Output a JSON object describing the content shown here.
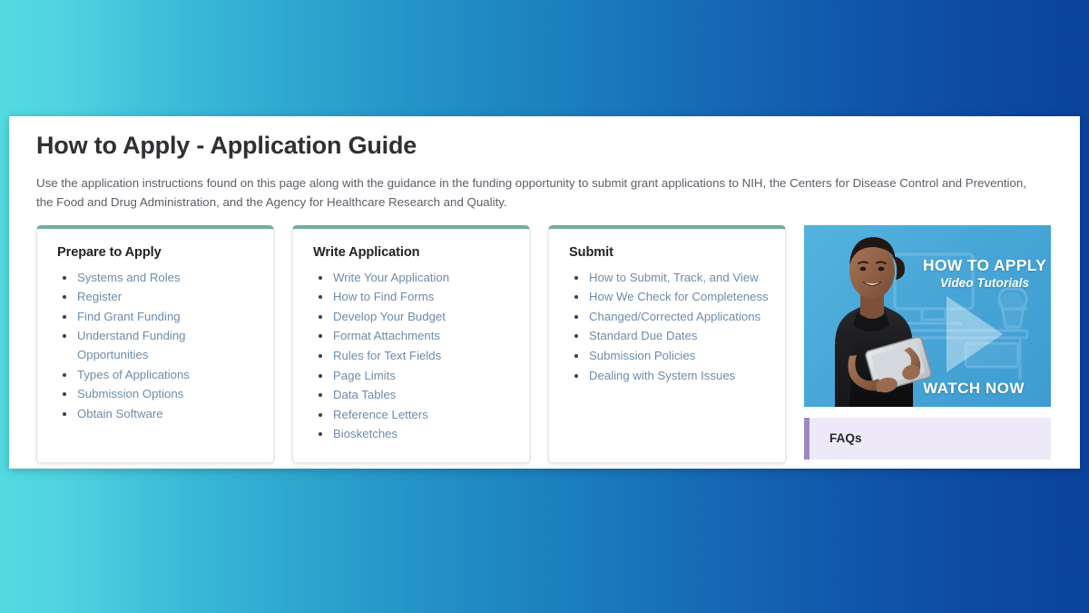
{
  "page": {
    "title": "How to Apply - Application Guide",
    "intro": "Use the application instructions found on this page along with the guidance in the funding opportunity to submit grant applications to NIH, the Centers for Disease Control and Prevention, the Food and Drug Administration, and the Agency for Healthcare Research and Quality."
  },
  "theme": {
    "bg_gradient_start": "#52dbe3",
    "bg_gradient_end": "#0b439e",
    "card_accent": "#6fae9e",
    "link_color": "#6d8cab",
    "faq_accent": "#9c88c6",
    "faq_background": "#eee9f8",
    "video_background": "#46a4d6"
  },
  "columns": [
    {
      "heading": "Prepare to Apply",
      "links": [
        "Systems and Roles",
        "Register",
        "Find Grant Funding",
        "Understand Funding Opportunities",
        "Types of Applications",
        "Submission Options",
        "Obtain Software"
      ]
    },
    {
      "heading": "Write Application",
      "links": [
        "Write Your Application",
        "How to Find Forms",
        "Develop Your Budget",
        "Format Attachments",
        "Rules for Text Fields",
        "Page Limits",
        "Data Tables",
        "Reference Letters",
        "Biosketches"
      ]
    },
    {
      "heading": "Submit",
      "links": [
        "How to Submit, Track, and View",
        "How We Check for Completeness",
        "Changed/Corrected Applications",
        "Standard Due Dates",
        "Submission Policies",
        "Dealing with System Issues"
      ]
    }
  ],
  "video_promo": {
    "title": "HOW TO APPLY",
    "subtitle": "Video Tutorials",
    "cta": "WATCH NOW",
    "play_icon": "play-triangle-icon"
  },
  "faqs": {
    "label": "FAQs"
  }
}
